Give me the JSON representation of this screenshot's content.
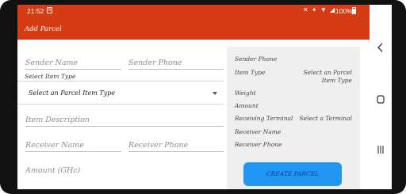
{
  "status_bar": {
    "time": "21:52",
    "notification_glyph": "S",
    "icons": "✕ ✦ ▼ ◢",
    "battery": "100%"
  },
  "app_bar": {
    "title": "Add Parcel"
  },
  "form": {
    "sender_name_placeholder": "Sender Name",
    "sender_phone_placeholder": "Sender Phone",
    "item_type_label": "Select Item Type",
    "item_type_selected": "Select an Parcel Item Type",
    "item_description_placeholder": "Item Description",
    "receiver_name_placeholder": "Receiver Name",
    "receiver_phone_placeholder": "Receiver Phone",
    "amount_placeholder": "Amount (GHc)"
  },
  "summary": {
    "sender_phone_label": "Sender Phone",
    "item_type_label": "Item Type",
    "item_type_value": "Select an Parcel Item Type",
    "weight_label": "Weight",
    "amount_label": "Amount",
    "receiving_terminal_label": "Receiving Terminal",
    "receiving_terminal_value": "Select a Terminal",
    "receiver_name_label": "Receiver Name",
    "receiver_phone_label": "Receiver Phone",
    "create_button_label": "CREATE PARCEL"
  },
  "colors": {
    "app_bar": "#d63c14",
    "button": "#2196f3",
    "panel": "#efefef"
  },
  "nav": {
    "back_icon": "back-chevron",
    "home_icon": "home-rounded-square",
    "recent_icon": "recent-apps-bars"
  }
}
